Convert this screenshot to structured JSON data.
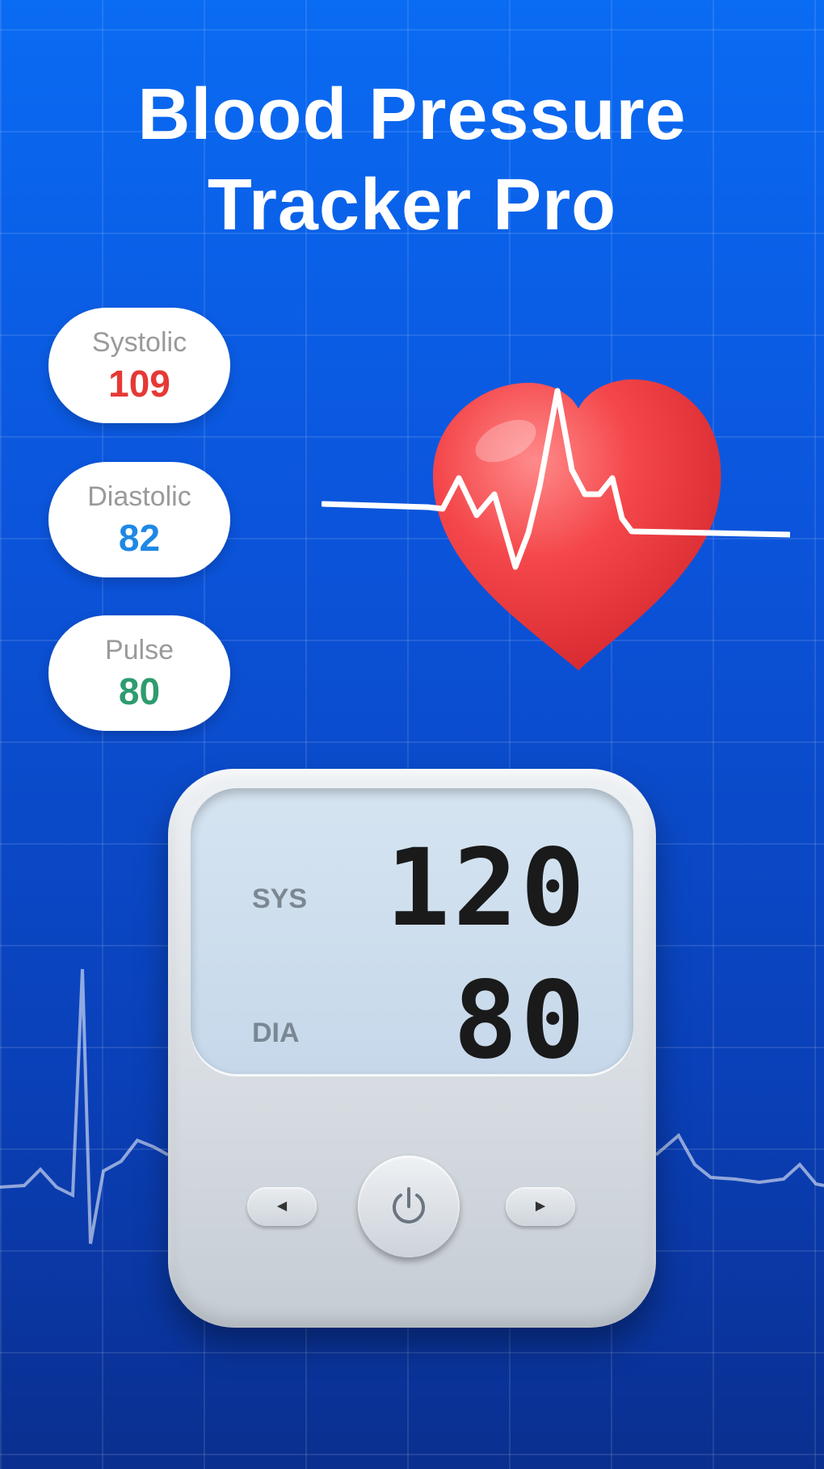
{
  "title": {
    "line1": "Blood Pressure",
    "line2": "Tracker Pro"
  },
  "readings": [
    {
      "label": "Systolic",
      "value": "109",
      "color": "#e53935"
    },
    {
      "label": "Diastolic",
      "value": "82",
      "color": "#1e88e5"
    },
    {
      "label": "Pulse",
      "value": "80",
      "color": "#2e9c6e"
    }
  ],
  "monitor": {
    "sys_label": "SYS",
    "sys_value": "120",
    "dia_label": "DIA",
    "dia_value": "80"
  },
  "icons": {
    "heart": "heart-icon",
    "power": "power-icon",
    "left": "chevron-left-icon",
    "right": "chevron-right-icon"
  },
  "colors": {
    "background_top": "#0a6bf3",
    "background_bottom": "#0a2f8f",
    "heart": "#f03a3f"
  }
}
